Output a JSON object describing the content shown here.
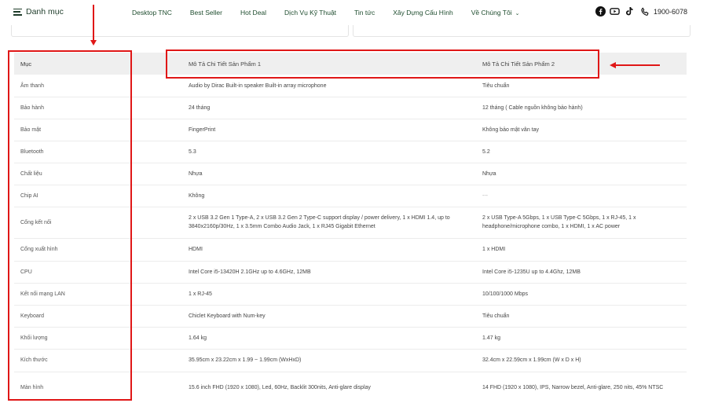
{
  "header": {
    "menu_label": "Danh mục",
    "nav": [
      "Desktop TNC",
      "Best Seller",
      "Hot Deal",
      "Dịch Vụ Kỹ Thuật",
      "Tin tức",
      "Xây Dựng Cấu Hình",
      "Về Chúng Tôi"
    ],
    "phone": "1900-6078",
    "social_icons": [
      "facebook-icon",
      "youtube-icon",
      "tiktok-icon",
      "phone-icon"
    ]
  },
  "table": {
    "headers": {
      "category": "Mục",
      "product1": "Mô Tả Chi Tiết Sản Phẩm 1",
      "product2": "Mô Tả Chi Tiết Sản Phẩm 2"
    },
    "rows": [
      {
        "label": "Âm thanh",
        "p1": "Audio by Dirac Built-in speaker Built-in array microphone",
        "p2": "Tiêu chuẩn"
      },
      {
        "label": "Bảo hành",
        "p1": "24 tháng",
        "p2": "12 tháng ( Cable nguồn không bảo hành)"
      },
      {
        "label": "Bảo mật",
        "p1": "FingerPrint",
        "p2": "Không bảo mật vân tay"
      },
      {
        "label": "Bluetooth",
        "p1": "5.3",
        "p2": "5.2"
      },
      {
        "label": "Chất liệu",
        "p1": "Nhựa",
        "p2": "Nhựa"
      },
      {
        "label": "Chip AI",
        "p1": "Không",
        "p2": "---"
      },
      {
        "label": "Cổng kết nối",
        "p1": "2 x USB 3.2 Gen 1 Type-A, 2 x USB 3.2 Gen 2 Type-C support display / power delivery, 1 x HDMI 1.4, up to 3840x2160p/30Hz, 1 x 3.5mm Combo Audio Jack, 1 x RJ45 Gigabit Ethernet",
        "p2": "2 x USB Type-A 5Gbps, 1 x USB Type-C 5Gbps, 1 x RJ-45, 1 x headphone/microphone combo, 1 x HDMI, 1 x AC power"
      },
      {
        "label": "Cổng xuất hình",
        "p1": "HDMI",
        "p2": "1 x HDMI"
      },
      {
        "label": "CPU",
        "p1": "Intel Core i5-13420H 2.1GHz up to 4.6GHz, 12MB",
        "p2": "Intel Core i5-1235U up to 4.4Ghz, 12MB"
      },
      {
        "label": "Kết nối mạng LAN",
        "p1": "1 x RJ-45",
        "p2": "10/100/1000 Mbps"
      },
      {
        "label": "Keyboard",
        "p1": "Chiclet Keyboard with Num-key",
        "p2": "Tiêu chuẩn"
      },
      {
        "label": "Khối lượng",
        "p1": "1.64 kg",
        "p2": "1.47 kg"
      },
      {
        "label": "Kích thước",
        "p1": "35.95cm x 23.22cm x 1.99 ~ 1.99cm (WxHxD)",
        "p2": "32.4cm x 22.59cm x 1.99cm (W x D x H)"
      },
      {
        "label": "Màn hình",
        "p1": "15.6 inch FHD (1920 x 1080), Led, 60Hz, Backlit 300nits, Anti-glare display",
        "p2": "14 FHD (1920 x 1080), IPS, Narrow bezel, Anti-glare, 250 nits, 45% NTSC"
      }
    ]
  },
  "colors": {
    "annotation": "#e01717",
    "brand_text": "#1f4d2f",
    "header_row_bg": "#efefef"
  }
}
